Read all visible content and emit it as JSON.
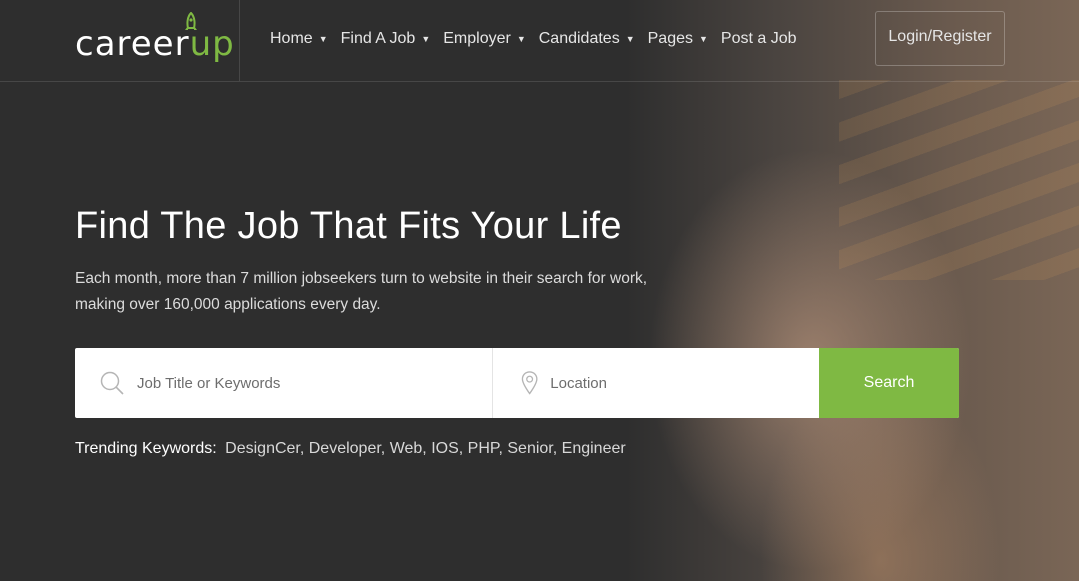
{
  "header": {
    "logo": {
      "main": "career",
      "accent": "up"
    },
    "nav": [
      {
        "label": "Home",
        "has_caret": true
      },
      {
        "label": "Find A Job",
        "has_caret": true
      },
      {
        "label": "Employer",
        "has_caret": true
      },
      {
        "label": "Candidates",
        "has_caret": true
      },
      {
        "label": "Pages",
        "has_caret": true
      },
      {
        "label": "Post a Job",
        "has_caret": false
      }
    ],
    "login_label": "Login/Register"
  },
  "hero": {
    "title": "Find The Job That Fits Your Life",
    "subtitle": "Each month, more than 7 million jobseekers turn to website in their search for work, making over 160,000 applications every day."
  },
  "search": {
    "keyword_placeholder": "Job Title or Keywords",
    "location_placeholder": "Location",
    "button_label": "Search"
  },
  "trending": {
    "label": "Trending Keywords:",
    "keywords": [
      "DesignCer",
      "Developer",
      "Web",
      "IOS",
      "PHP",
      "Senior",
      "Engineer"
    ]
  },
  "colors": {
    "accent": "#7fb943",
    "background": "#2f2f2f"
  },
  "icons": {
    "search": "search-icon",
    "location": "location-pin-icon",
    "caret": "caret-down-icon",
    "rocket": "rocket-icon"
  }
}
